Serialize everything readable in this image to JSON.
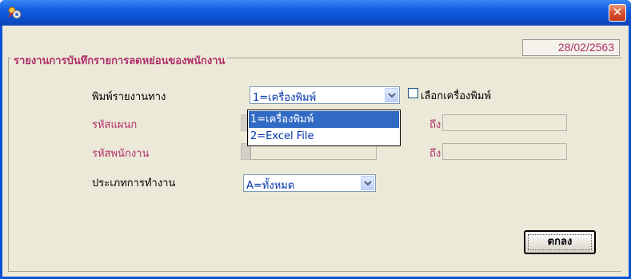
{
  "window": {
    "close_symbol": "✕",
    "icon": "app-icon"
  },
  "header": {
    "date": "28/02/2563"
  },
  "group": {
    "title": "รายงานการบันทึกรายการลดหย่อนของพนักงาน"
  },
  "form": {
    "print_to_label": "พิมพ์รายงานทาง",
    "print_to_value": "1=เครื่องพิมพ์",
    "select_printer_label": "เลือกเครื่องพิมพ์",
    "select_printer_checked": false,
    "dept_code_label": "รหัสแผนก",
    "emp_code_label": "รหัสพนักงาน",
    "to_label": "ถึง",
    "work_type_label": "ประเภทการทำงาน",
    "work_type_value": "A=ทั้งหมด"
  },
  "dropdown": {
    "options": [
      "1=เครื่องพิมพ์",
      "2=Excel File"
    ],
    "selected_index": 0
  },
  "buttons": {
    "ok_label": "ตกลง"
  },
  "colors": {
    "title_bar": "#0a53d7",
    "accent_text": "#b0306a",
    "selection": "#316ac5"
  }
}
